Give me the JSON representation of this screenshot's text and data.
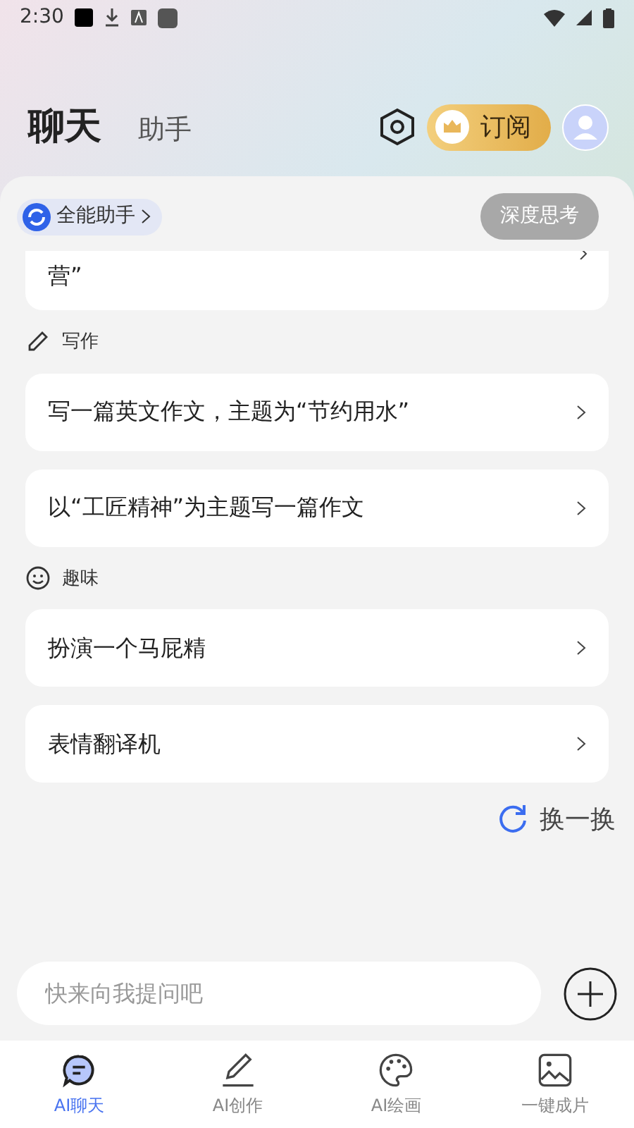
{
  "status_bar": {
    "time": "2:30"
  },
  "header_tabs": [
    {
      "label": "聊天",
      "selected": true
    },
    {
      "label": "助手",
      "selected": false
    }
  ],
  "subscribe_button": "订阅",
  "assistant_chip": "全能助手",
  "deep_think_button": {
    "label": "深度思考",
    "selected": false
  },
  "partial_card": "营”",
  "sections": [
    {
      "kind": "pencil",
      "title": "写作",
      "items": [
        "写一篇英文作文，主题为“节约用水”",
        "以“工匠精神”为主题写一篇作文"
      ]
    },
    {
      "kind": "smiley",
      "title": "趣味",
      "items": [
        "扮演一个马屁精",
        "表情翻译机"
      ]
    }
  ],
  "refresh_button": "换一换",
  "input": {
    "placeholder": "快来向我提问吧"
  },
  "bottom_nav": [
    {
      "kind": "chat",
      "label": "AI聊天",
      "selected": true
    },
    {
      "kind": "pencil",
      "label": "AI创作",
      "selected": false
    },
    {
      "kind": "palette",
      "label": "AI绘画",
      "selected": false
    },
    {
      "kind": "image",
      "label": "一键成片",
      "selected": false
    }
  ]
}
